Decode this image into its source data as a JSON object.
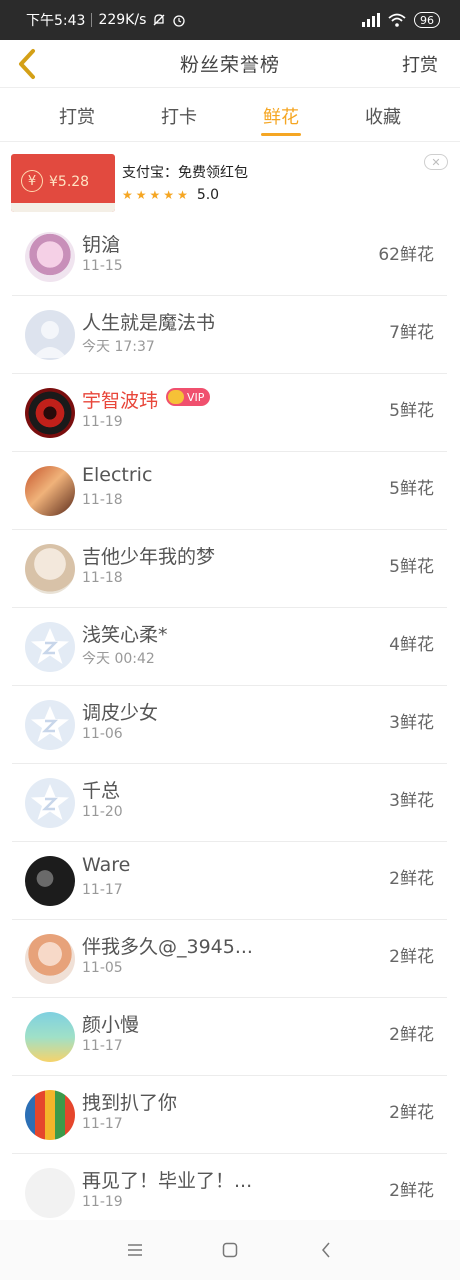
{
  "status_bar": {
    "time": "下午5:43",
    "speed": "229K/s",
    "battery": "96"
  },
  "header": {
    "title": "粉丝荣誉榜",
    "action": "打赏"
  },
  "tabs": [
    {
      "label": "打赏"
    },
    {
      "label": "打卡"
    },
    {
      "label": "鲜花",
      "active": true
    },
    {
      "label": "收藏"
    }
  ],
  "ad": {
    "amount": "¥5.28",
    "title": "支付宝：免费领红包",
    "rating": "5.0"
  },
  "fans": [
    {
      "name": "钥滄",
      "date": "11-15",
      "count": "62鲜花",
      "vip": false,
      "avatar": "anime-girl"
    },
    {
      "name": "人生就是魔法书",
      "date": "今天 17:37",
      "count": "7鲜花",
      "vip": false,
      "avatar": "default-person"
    },
    {
      "name": "宇智波玮",
      "date": "11-19",
      "count": "5鲜花",
      "vip": true,
      "vip_label": "VIP",
      "avatar": "sharingan"
    },
    {
      "name": "Electric",
      "date": "11-18",
      "count": "5鲜花",
      "vip": false,
      "avatar": "anime-couple"
    },
    {
      "name": "吉他少年我的梦",
      "date": "11-18",
      "count": "5鲜花",
      "vip": false,
      "avatar": "plush-bunny"
    },
    {
      "name": "浅笑心柔*",
      "date": "今天 00:42",
      "count": "4鲜花",
      "vip": false,
      "avatar": "qq-default"
    },
    {
      "name": "调皮少女",
      "date": "11-06",
      "count": "3鲜花",
      "vip": false,
      "avatar": "qq-default"
    },
    {
      "name": "千总",
      "date": "11-20",
      "count": "3鲜花",
      "vip": false,
      "avatar": "qq-default"
    },
    {
      "name": "Ware",
      "date": "11-17",
      "count": "2鲜花",
      "vip": false,
      "avatar": "dark-photo"
    },
    {
      "name": "伴我多久@_3945...",
      "date": "11-05",
      "count": "2鲜花",
      "vip": false,
      "avatar": "girl-photo"
    },
    {
      "name": "颜小慢",
      "date": "11-17",
      "count": "2鲜花",
      "vip": false,
      "avatar": "cartoon-kids"
    },
    {
      "name": "拽到扒了你",
      "date": "11-17",
      "count": "2鲜花",
      "vip": false,
      "avatar": "pencils"
    },
    {
      "name": "再见了！毕业了！...",
      "date": "11-19",
      "count": "2鲜花",
      "vip": false,
      "avatar": "faded-photo"
    }
  ],
  "colors": {
    "accent": "#f5a623",
    "vip_name": "#e8463a",
    "ad_red": "#e24a3f"
  }
}
